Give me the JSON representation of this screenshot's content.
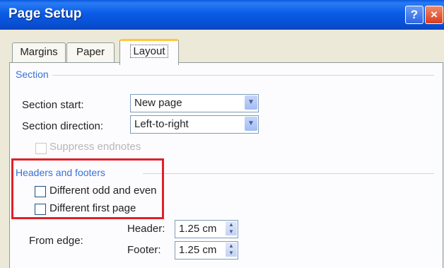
{
  "window": {
    "title": "Page Setup",
    "help_label": "?",
    "close_label": "×"
  },
  "tabs": [
    {
      "label": "Margins",
      "active": false
    },
    {
      "label": "Paper",
      "active": false
    },
    {
      "label": "Layout",
      "active": true
    }
  ],
  "section": {
    "group_title": "Section",
    "start_label": "Section start:",
    "start_value": "New page",
    "direction_label": "Section direction:",
    "direction_value": "Left-to-right",
    "suppress_label": "Suppress endnotes"
  },
  "headers_footers": {
    "group_title": "Headers and footers",
    "odd_even_label": "Different odd and even",
    "first_page_label": "Different first page",
    "from_edge_label": "From edge:",
    "header_label": "Header:",
    "header_value": "1.25 cm",
    "footer_label": "Footer:",
    "footer_value": "1.25 cm"
  },
  "colors": {
    "title_bar": "#0a5be6",
    "highlight": "#e0202a",
    "group_title": "#3a6fd8"
  }
}
